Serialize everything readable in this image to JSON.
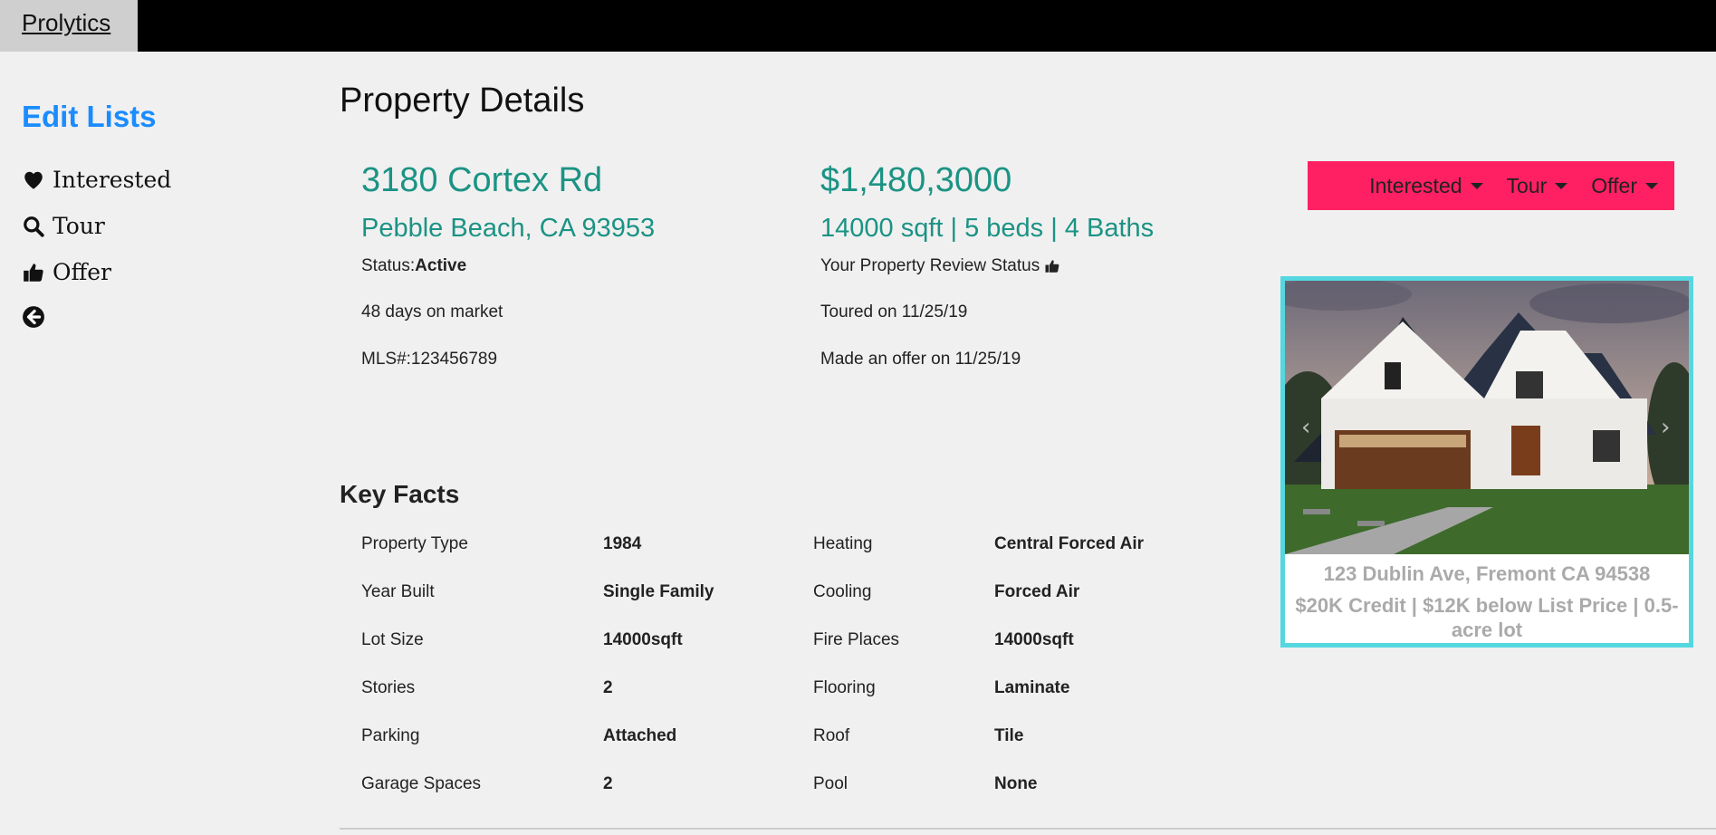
{
  "navbar": {
    "brand": "Prolytics"
  },
  "sidebar": {
    "title": "Edit Lists",
    "items": [
      {
        "label": "Interested",
        "icon": "heart-icon"
      },
      {
        "label": "Tour",
        "icon": "search-icon"
      },
      {
        "label": "Offer",
        "icon": "thumbs-up-icon"
      },
      {
        "label": "",
        "icon": "back-arrow-icon"
      }
    ]
  },
  "page": {
    "title": "Property Details"
  },
  "property": {
    "address_line1": "3180 Cortex Rd",
    "address_line2": "Pebble Beach, CA 93953",
    "status_label": "Status:",
    "status_value": "Active",
    "days_on_market": "48 days on market",
    "mls": "MLS#:123456789",
    "price": "$1,480,3000",
    "specs": "14000 sqft | 5 beds | 4 Baths",
    "review_status": "Your Property Review Status",
    "toured": "Toured on 11/25/19",
    "offer": "Made an offer on 11/25/19"
  },
  "actions": {
    "interested": "Interested",
    "tour": "Tour",
    "offer": "Offer",
    "bar_color": "#ff1f63"
  },
  "carousel": {
    "address": "123 Dublin Ave, Fremont CA 94538",
    "description": "$20K Credit | $12K below List Price | 0.5-acre lot",
    "border_color": "#55d7e0"
  },
  "key_facts": {
    "title": "Key Facts",
    "rows": [
      {
        "label1": "Property Type",
        "value1": "1984",
        "label2": "Heating",
        "value2": "Central Forced Air"
      },
      {
        "label1": "Year Built",
        "value1": "Single Family",
        "label2": "Cooling",
        "value2": "Forced Air"
      },
      {
        "label1": "Lot Size",
        "value1": "14000sqft",
        "label2": "Fire Places",
        "value2": "14000sqft"
      },
      {
        "label1": "Stories",
        "value1": "2",
        "label2": "Flooring",
        "value2": "Laminate"
      },
      {
        "label1": "Parking",
        "value1": "Attached",
        "label2": "Roof",
        "value2": "Tile"
      },
      {
        "label1": "Garage Spaces",
        "value1": "2",
        "label2": "Pool",
        "value2": "None"
      }
    ]
  },
  "colors": {
    "accent_teal": "#1b9384",
    "link_blue": "#1a8cff"
  }
}
